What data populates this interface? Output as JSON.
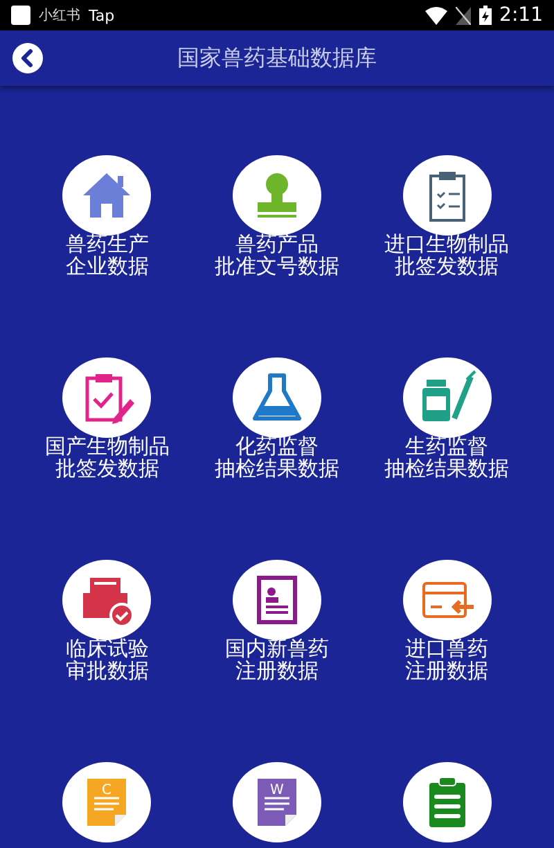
{
  "status_bar": {
    "app_label": "小红书",
    "notification": "Tap",
    "time": "2:11"
  },
  "header": {
    "title": "国家兽药基础数据库"
  },
  "tiles": [
    {
      "kind": "labeled",
      "lines": [
        "兽药生产",
        "企业数据"
      ]
    },
    {
      "kind": "labeled",
      "lines": [
        "兽药产品",
        "批准文号数据"
      ]
    },
    {
      "kind": "labeled",
      "lines": [
        "进口生物制品",
        "批签发数据"
      ]
    },
    {
      "kind": "labeled",
      "lines": [
        "国产生物制品",
        "批签发数据"
      ]
    },
    {
      "kind": "labeled",
      "lines": [
        "化药监督",
        "抽检结果数据"
      ]
    },
    {
      "kind": "labeled",
      "lines": [
        "生药监督",
        "抽检结果数据"
      ]
    },
    {
      "kind": "labeled",
      "lines": [
        "临床试验",
        "审批数据"
      ]
    },
    {
      "kind": "labeled",
      "lines": [
        "国内新兽药",
        "注册数据"
      ]
    },
    {
      "kind": "labeled",
      "lines": [
        "进口兽药",
        "注册数据"
      ]
    },
    {
      "kind": "lettered",
      "glyph": "C"
    },
    {
      "kind": "lettered",
      "glyph": "W"
    },
    {
      "kind": "plain"
    }
  ]
}
